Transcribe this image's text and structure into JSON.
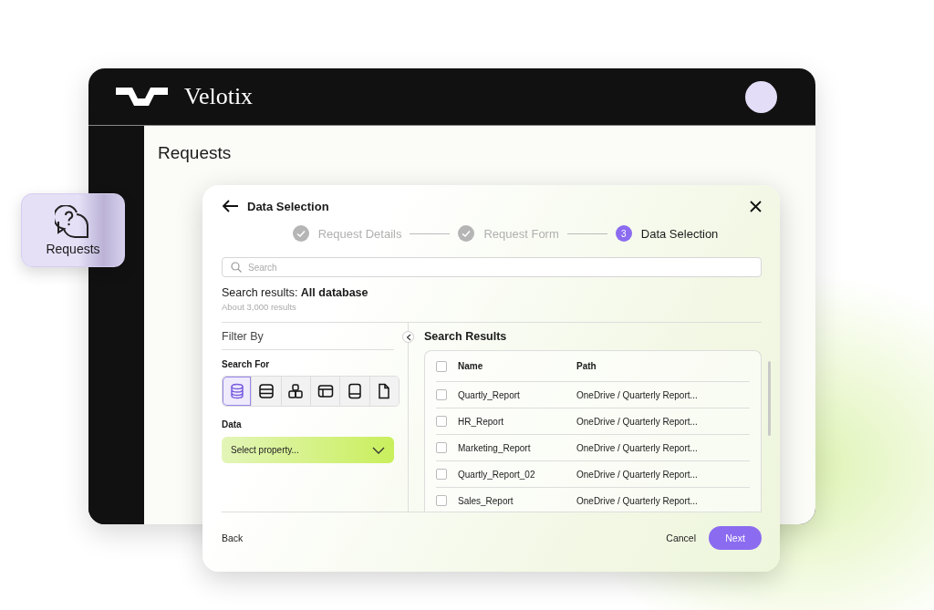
{
  "app": {
    "logo_text": "Velotix",
    "page_title": "Requests"
  },
  "floating_card": {
    "label": "Requests"
  },
  "dialog": {
    "title": "Data Selection",
    "steps": [
      {
        "label": "Request Details",
        "done": true
      },
      {
        "label": "Request Form",
        "done": true
      },
      {
        "label": "Data Selection",
        "done": false,
        "number": "3"
      }
    ],
    "search": {
      "placeholder": "Search"
    },
    "results_summary": "Search results: **All database**",
    "results_count": "About 3,000 results",
    "filter": {
      "title": "Filter By",
      "search_for_label": "Search For",
      "types": [
        {
          "kind": "database",
          "selected": true
        },
        {
          "kind": "rows",
          "selected": false
        },
        {
          "kind": "blocks",
          "selected": false
        },
        {
          "kind": "window",
          "selected": false
        },
        {
          "kind": "tablet",
          "selected": false
        },
        {
          "kind": "file",
          "selected": false
        }
      ],
      "data_label": "Data",
      "data_select": {
        "placeholder": "Select property..."
      }
    },
    "results": {
      "title": "Search Results",
      "columns": [
        "Name",
        "Path"
      ],
      "select_all_checked": false,
      "rows": [
        {
          "name": "Quartly_Report",
          "path": "OneDrive / Quarterly Report...",
          "checked": false
        },
        {
          "name": "HR_Report",
          "path": "OneDrive / Quarterly Report...",
          "checked": false
        },
        {
          "name": "Marketing_Report",
          "path": "OneDrive / Quarterly Report...",
          "checked": false
        },
        {
          "name": "Quartly_Report_02",
          "path": "OneDrive / Quarterly Report...",
          "checked": false
        },
        {
          "name": "Sales_Report",
          "path": "OneDrive / Quarterly Report...",
          "checked": false
        }
      ]
    },
    "footer": {
      "back": "Back",
      "cancel": "Cancel",
      "next": "Next"
    }
  }
}
